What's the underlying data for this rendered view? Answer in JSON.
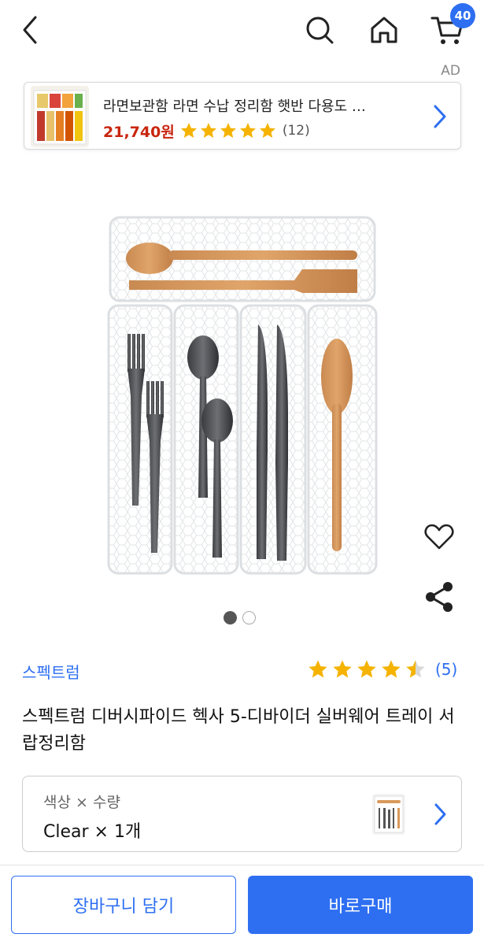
{
  "header": {
    "cart_count": "40",
    "back_icon": "chevron-left-icon",
    "search_icon": "search-icon",
    "home_icon": "home-icon",
    "cart_icon": "cart-icon",
    "accent_color": "#2e6ff2"
  },
  "ad": {
    "label": "AD",
    "title": "라면보관함 라면 수납 정리함 햇반 다용도 …",
    "price": "21,740원",
    "rating_stars": 5,
    "review_count": "(12)",
    "price_color": "#c8260f"
  },
  "product": {
    "image_index": 1,
    "image_total": 2,
    "brand": "스펙트럼",
    "rating": 4.5,
    "review_count": "(5)",
    "title": "스펙트럼 디버시파이드 헥사 5-디바이더 실버웨어 트레이 서랍정리함"
  },
  "option": {
    "label": "색상 × 수량",
    "value": "Clear × 1개"
  },
  "actions": {
    "add_to_cart": "장바구니 담기",
    "buy_now": "바로구매"
  }
}
